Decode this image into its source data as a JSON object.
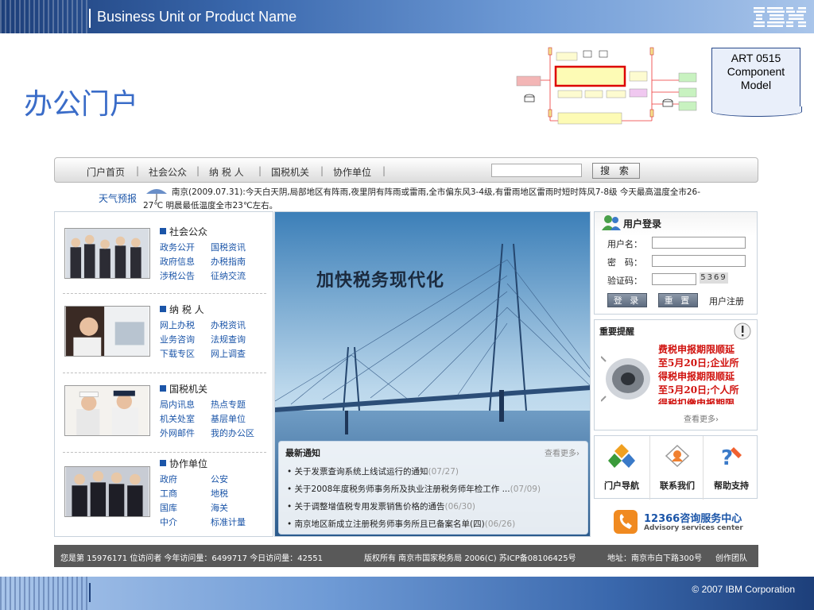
{
  "header": {
    "unit_name": "Business Unit or Product Name",
    "logo": "IBM"
  },
  "slide_title": "办公门户",
  "art_box": {
    "line1": "ART 0515",
    "line2": "Component",
    "line3": "Model"
  },
  "portal": {
    "nav": {
      "items": [
        "门户首页",
        "社会公众",
        "纳 税 人",
        "国税机关",
        "协作单位"
      ],
      "search_button": "搜 索"
    },
    "weather": {
      "label": "天气预报",
      "text": "南京(2009.07.31):今天白天阴,局部地区有阵雨,夜里阴有阵雨或雷雨,全市偏东风3-4级,有雷雨地区雷雨时短时阵风7-8级 今天最高温度全市26-27℃ 明晨最低温度全市23℃左右。"
    },
    "sections": [
      {
        "title": "社会公众",
        "links": [
          "政务公开",
          "国税资讯",
          "政府信息",
          "办税指南",
          "涉税公告",
          "征纳交流"
        ]
      },
      {
        "title": "纳 税 人",
        "links": [
          "网上办税",
          "办税资讯",
          "业务咨询",
          "法规查询",
          "下载专区",
          "网上调查"
        ]
      },
      {
        "title": "国税机关",
        "links": [
          "局内讯息",
          "热点专题",
          "机关处室",
          "基层单位",
          "外网邮件",
          "我的办公区"
        ]
      },
      {
        "title": "协作单位",
        "links": [
          "政府",
          "公安",
          "工商",
          "地税",
          "国库",
          "海关",
          "中介",
          "标准计量"
        ]
      }
    ],
    "banner": {
      "headline": "加快税务现代化"
    },
    "news": {
      "title": "最新通知",
      "more": "查看更多›",
      "items": [
        {
          "text": "关于发票查询系统上线试运行的通知",
          "date": "(07/27)"
        },
        {
          "text": "关于2008年度税务师事务所及执业注册税务师年检工作 ...",
          "date": "(07/09)"
        },
        {
          "text": "关于调整增值税专用发票销售价格的通告",
          "date": "(06/30)"
        },
        {
          "text": "南京地区新成立注册税务师事务所且已备案名单(四)",
          "date": "(06/26)"
        }
      ]
    },
    "login": {
      "title": "用户登录",
      "username_label": "用户名：",
      "password_label": "密　码：",
      "captcha_label": "验证码：",
      "captcha_code": "5369",
      "login_button": "登 录",
      "reset_button": "重 置",
      "register": "用户注册"
    },
    "notice": {
      "title": "重要提醒",
      "lines": [
        "费税申报期限顺延",
        "至5月20日;企业所",
        "得税申报期限顺延",
        "至5月20日;个人所",
        "得税扣缴申报期限"
      ],
      "more": "查看更多›"
    },
    "quick": [
      {
        "label": "门户导航",
        "icon": "navigation-icon"
      },
      {
        "label": "联系我们",
        "icon": "contact-icon"
      },
      {
        "label": "帮助支持",
        "icon": "help-icon"
      }
    ],
    "hotline": {
      "number": "12366咨询服务中心",
      "subtitle": "Advisory services center"
    },
    "footer": {
      "visitors": "您是第 15976171 位访问者 今年访问量：6499717 今日访问量：42551",
      "rights": "版权所有  南京市国家税务局  2006(C)  苏ICP备08106425号",
      "address": "地址：南京市白下路300号",
      "team": "创作团队"
    }
  },
  "slide_footer": {
    "copyright": "© 2007 IBM Corporation"
  }
}
